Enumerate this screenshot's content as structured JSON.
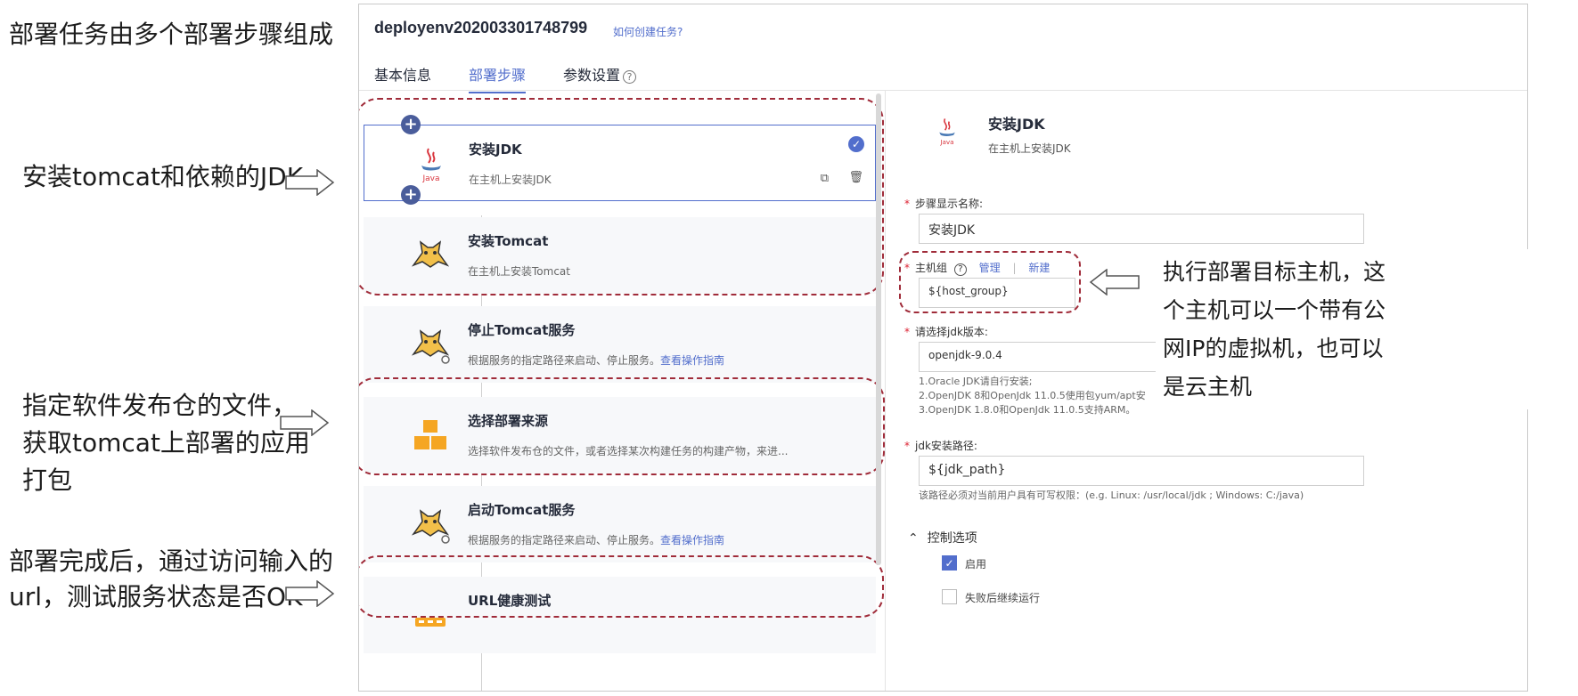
{
  "annotations": {
    "top": "部署任务由多个部署步骤组成",
    "jdk": "安装tomcat和依赖的JDK",
    "source_line1": "指定软件发布仓的文件，",
    "source_line2": "获取tomcat上部署的应用",
    "source_line3": "打包",
    "url_line1": "部署完成后，通过访问输入的",
    "url_line2": "url，测试服务状态是否OK",
    "host_callout": "执行部署目标主机，这个主机可以一个带有公网IP的虚拟机，也可以是云主机"
  },
  "header": {
    "title": "deployenv202003301748799",
    "help_link": "如何创建任务?"
  },
  "tabs": [
    {
      "label": "基本信息"
    },
    {
      "label": "部署步骤"
    },
    {
      "label": "参数设置"
    }
  ],
  "steps": [
    {
      "title": "安装JDK",
      "desc": "在主机上安装JDK",
      "icon": "java-icon"
    },
    {
      "title": "安装Tomcat",
      "desc": "在主机上安装Tomcat",
      "icon": "tomcat-icon"
    },
    {
      "title": "停止Tomcat服务",
      "desc": "根据服务的指定路径来启动、停止服务。",
      "link": "查看操作指南",
      "icon": "tomcat-gear-icon"
    },
    {
      "title": "选择部署来源",
      "desc": "选择软件发布仓的文件，或者选择某次构建任务的构建产物，来进...",
      "icon": "package-icon"
    },
    {
      "title": "启动Tomcat服务",
      "desc": "根据服务的指定路径来启动、停止服务。",
      "link": "查看操作指南",
      "icon": "tomcat-gear-icon"
    },
    {
      "title": "URL健康测试",
      "icon": "url-icon"
    }
  ],
  "detail": {
    "title": "安装JDK",
    "subtitle": "在主机上安装JDK",
    "name_label": "步骤显示名称:",
    "name_value": "安装JDK",
    "host_label": "主机组",
    "host_manage": "管理",
    "host_sep": "|",
    "host_new": "新建",
    "host_value": "${host_group}",
    "jdk_label": "请选择jdk版本:",
    "jdk_value": "openjdk-9.0.4",
    "jdk_hint1": "1.Oracle JDK请自行安装;",
    "jdk_hint2": "2.OpenJDK 8和OpenJdk 11.0.5使用包yum/apt安",
    "jdk_hint3": "3.OpenJDK 1.8.0和OpenJdk 11.0.5支持ARM。",
    "path_label": "jdk安装路径:",
    "path_value": "${jdk_path}",
    "path_hint": "该路径必须对当前用户具有可写权限：(e.g. Linux: /usr/local/jdk ; Windows: C:/java)",
    "control_label": "控制选项",
    "enable_label": "启用",
    "continue_label": "失败后继续运行"
  },
  "colors": {
    "accent": "#526ecc",
    "dashed": "#a02c3a",
    "plus": "#4a5d9b",
    "package": "#f5a623"
  }
}
